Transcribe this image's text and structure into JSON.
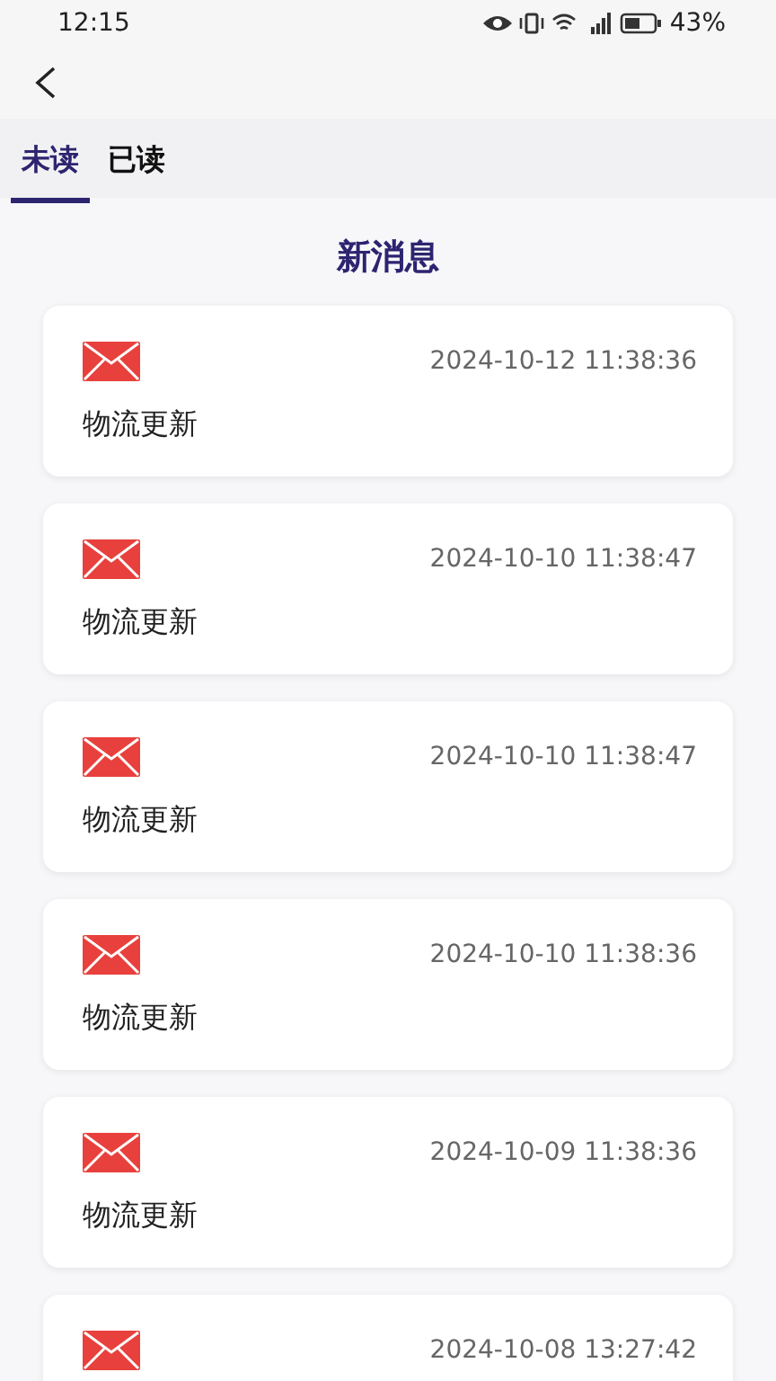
{
  "status_bar": {
    "time": "12:15",
    "battery": "43%"
  },
  "tabs": [
    {
      "label": "未读",
      "selected": true
    },
    {
      "label": "已读",
      "selected": false
    }
  ],
  "section_title": "新消息",
  "messages": [
    {
      "time": "2024-10-12 11:38:36",
      "title": "物流更新"
    },
    {
      "time": "2024-10-10 11:38:47",
      "title": "物流更新"
    },
    {
      "time": "2024-10-10 11:38:47",
      "title": "物流更新"
    },
    {
      "time": "2024-10-10 11:38:36",
      "title": "物流更新"
    },
    {
      "time": "2024-10-09 11:38:36",
      "title": "物流更新"
    },
    {
      "time": "2024-10-08 13:27:42"
    }
  ]
}
